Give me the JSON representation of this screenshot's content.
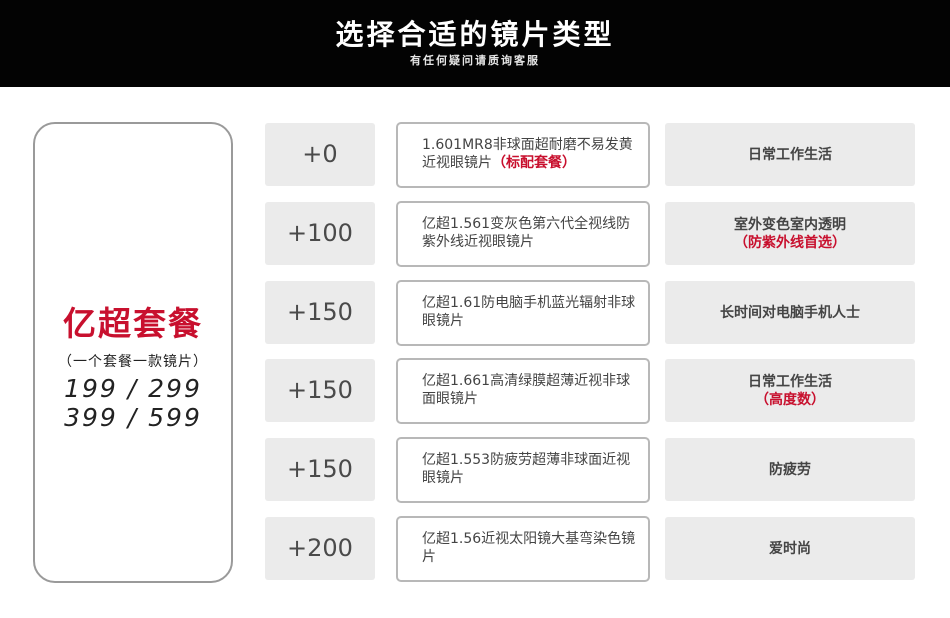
{
  "header": {
    "title": "选择合适的镜片类型",
    "subtitle": "有任何疑问请质询客服"
  },
  "package": {
    "name": "亿超套餐",
    "note": "（一个套餐一款镜片）",
    "price_line_1": "199 / 299",
    "price_line_2": "399 / 599"
  },
  "rows": [
    {
      "price": "+0",
      "lens": "1.601MR8非球面超耐磨不易发黄近视眼镜片",
      "lens_highlight": "（标配套餐）",
      "use": "日常工作生活",
      "use_highlight": ""
    },
    {
      "price": "+100",
      "lens": "亿超1.561变灰色第六代全视线防紫外线近视眼镜片",
      "lens_highlight": "",
      "use": "室外变色室内透明",
      "use_highlight": "（防紫外线首选）"
    },
    {
      "price": "+150",
      "lens": "亿超1.61防电脑手机蓝光辐射非球眼镜片",
      "lens_highlight": "",
      "use": "长时间对电脑手机人士",
      "use_highlight": ""
    },
    {
      "price": "+150",
      "lens": "亿超1.661高清绿膜超薄近视非球面眼镜片",
      "lens_highlight": "",
      "use": "日常工作生活",
      "use_highlight": "（高度数）"
    },
    {
      "price": "+150",
      "lens": "亿超1.553防疲劳超薄非球面近视眼镜片",
      "lens_highlight": "",
      "use": "防疲劳",
      "use_highlight": ""
    },
    {
      "price": "+200",
      "lens": "亿超1.56近视太阳镜大基弯染色镜片",
      "lens_highlight": "",
      "use": "爱时尚",
      "use_highlight": ""
    }
  ]
}
